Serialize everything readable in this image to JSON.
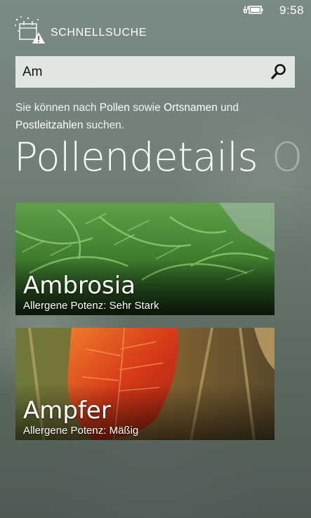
{
  "status_bar": {
    "time": "9:58",
    "battery_icon": "battery-charging-icon"
  },
  "header": {
    "app_title": "SCHNELLSUCHE",
    "logo_icon": "pollen-warning-logo-icon"
  },
  "search": {
    "value": "Am",
    "search_icon": "search-icon"
  },
  "hint": {
    "part1": "Sie können nach ",
    "kw1": "Pollen",
    "part2": " sowie ",
    "kw2": "Ortsnamen",
    "part3": " und ",
    "kw3": "Postleitzahlen",
    "part4": " suchen."
  },
  "pivot": {
    "active": "Pollendetails",
    "next": "O"
  },
  "results": [
    {
      "name": "Ambrosia",
      "potency_label": "Allergene Potenz",
      "potency_value": "Sehr Stark"
    },
    {
      "name": "Ampfer",
      "potency_label": "Allergene Potenz",
      "potency_value": "Mäßig"
    }
  ],
  "colors": {
    "accent": "#ffffff",
    "search_bg": "#e8ece8",
    "tile1_green": "#3f8a2f",
    "tile2_red": "#d43a1b"
  }
}
